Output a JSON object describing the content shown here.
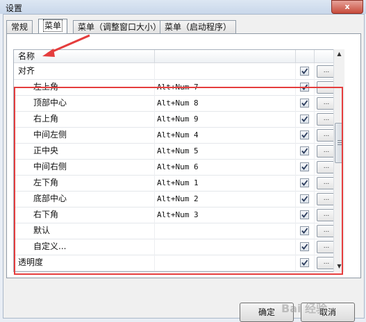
{
  "window": {
    "title": "设置",
    "close_label": "x"
  },
  "tabs": [
    {
      "label": "常规"
    },
    {
      "label": "菜单"
    },
    {
      "label": "菜单（调整窗口大小）"
    },
    {
      "label": "菜单（启动程序）"
    }
  ],
  "list": {
    "header": {
      "name": "名称"
    },
    "rows": [
      {
        "name": "对齐",
        "key": "",
        "checked": true,
        "dots": "..."
      },
      {
        "name": "左上角",
        "key": "Alt+Num 7",
        "checked": true,
        "dots": "..."
      },
      {
        "name": "顶部中心",
        "key": "Alt+Num 8",
        "checked": true,
        "dots": "..."
      },
      {
        "name": "右上角",
        "key": "Alt+Num 9",
        "checked": true,
        "dots": "..."
      },
      {
        "name": "中间左侧",
        "key": "Alt+Num 4",
        "checked": true,
        "dots": "..."
      },
      {
        "name": "正中央",
        "key": "Alt+Num 5",
        "checked": true,
        "dots": "..."
      },
      {
        "name": "中间右侧",
        "key": "Alt+Num 6",
        "checked": true,
        "dots": "..."
      },
      {
        "name": "左下角",
        "key": "Alt+Num 1",
        "checked": true,
        "dots": "..."
      },
      {
        "name": "底部中心",
        "key": "Alt+Num 2",
        "checked": true,
        "dots": "..."
      },
      {
        "name": "右下角",
        "key": "Alt+Num 3",
        "checked": true,
        "dots": "..."
      },
      {
        "name": "默认",
        "key": "",
        "checked": true,
        "dots": "..."
      },
      {
        "name": "自定义...",
        "key": "",
        "checked": true,
        "dots": "..."
      },
      {
        "name": "透明度",
        "key": "",
        "checked": true,
        "dots": "..."
      }
    ]
  },
  "buttons": {
    "ok": "确定",
    "cancel": "取消"
  },
  "watermark": "Bai 经验",
  "colors": {
    "highlight": "#e53d3d",
    "arrow": "#e53d3d"
  }
}
